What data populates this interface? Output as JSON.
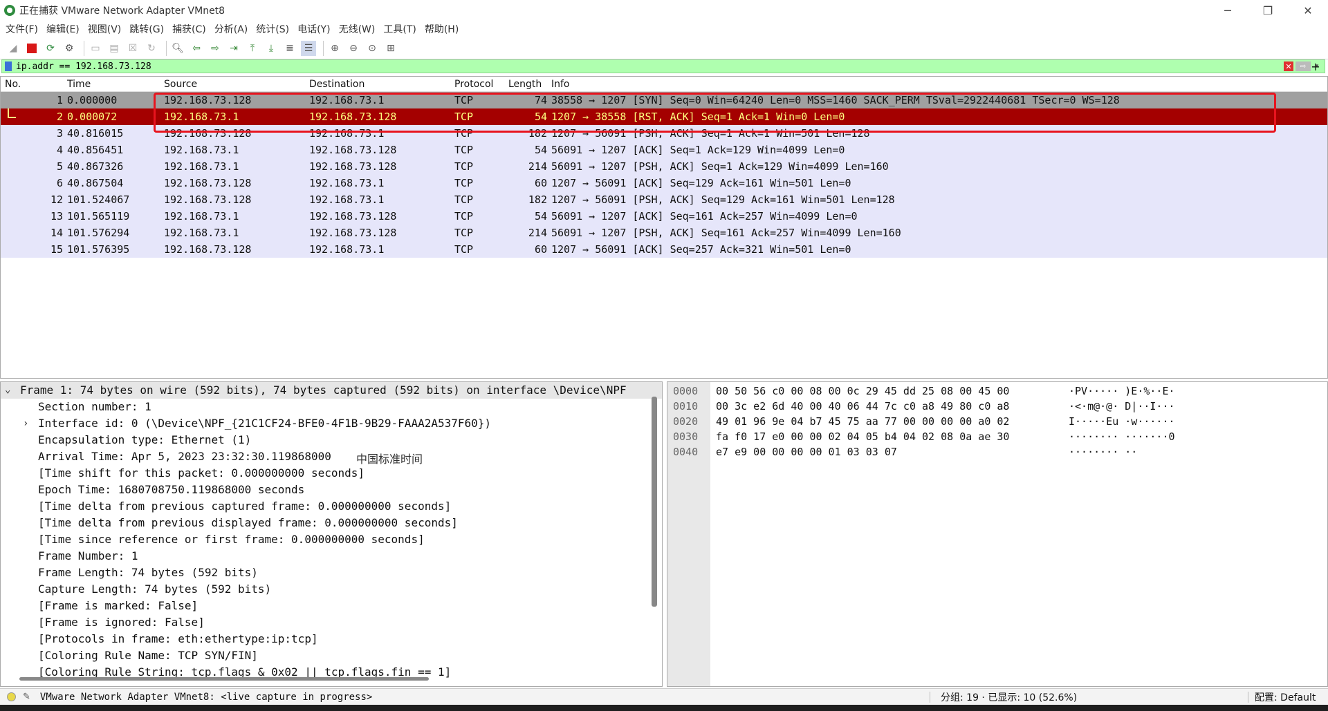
{
  "window": {
    "title": "正在捕获 VMware Network Adapter VMnet8"
  },
  "menu": [
    "文件(F)",
    "编辑(E)",
    "视图(V)",
    "跳转(G)",
    "捕获(C)",
    "分析(A)",
    "统计(S)",
    "电话(Y)",
    "无线(W)",
    "工具(T)",
    "帮助(H)"
  ],
  "filter": {
    "value": "ip.addr == 192.168.73.128",
    "clear_label": "✕",
    "apply_label": "⇨",
    "dropdown_label": "▾",
    "add_label": "+"
  },
  "columns": {
    "no": "No.",
    "time": "Time",
    "source": "Source",
    "destination": "Destination",
    "protocol": "Protocol",
    "length": "Length",
    "info": "Info"
  },
  "packets": [
    {
      "no": "1",
      "time": "0.000000",
      "src": "192.168.73.128",
      "dst": "192.168.73.1",
      "proto": "TCP",
      "len": "74",
      "info": "38558 → 1207 [SYN] Seq=0 Win=64240 Len=0 MSS=1460 SACK_PERM TSval=2922440681 TSecr=0 WS=128"
    },
    {
      "no": "2",
      "time": "0.000072",
      "src": "192.168.73.1",
      "dst": "192.168.73.128",
      "proto": "TCP",
      "len": "54",
      "info": "1207 → 38558 [RST, ACK] Seq=1 Ack=1 Win=0 Len=0"
    },
    {
      "no": "3",
      "time": "40.816015",
      "src": "192.168.73.128",
      "dst": "192.168.73.1",
      "proto": "TCP",
      "len": "182",
      "info": "1207 → 56091 [PSH, ACK] Seq=1 Ack=1 Win=501 Len=128"
    },
    {
      "no": "4",
      "time": "40.856451",
      "src": "192.168.73.1",
      "dst": "192.168.73.128",
      "proto": "TCP",
      "len": "54",
      "info": "56091 → 1207 [ACK] Seq=1 Ack=129 Win=4099 Len=0"
    },
    {
      "no": "5",
      "time": "40.867326",
      "src": "192.168.73.1",
      "dst": "192.168.73.128",
      "proto": "TCP",
      "len": "214",
      "info": "56091 → 1207 [PSH, ACK] Seq=1 Ack=129 Win=4099 Len=160"
    },
    {
      "no": "6",
      "time": "40.867504",
      "src": "192.168.73.128",
      "dst": "192.168.73.1",
      "proto": "TCP",
      "len": "60",
      "info": "1207 → 56091 [ACK] Seq=129 Ack=161 Win=501 Len=0"
    },
    {
      "no": "12",
      "time": "101.524067",
      "src": "192.168.73.128",
      "dst": "192.168.73.1",
      "proto": "TCP",
      "len": "182",
      "info": "1207 → 56091 [PSH, ACK] Seq=129 Ack=161 Win=501 Len=128"
    },
    {
      "no": "13",
      "time": "101.565119",
      "src": "192.168.73.1",
      "dst": "192.168.73.128",
      "proto": "TCP",
      "len": "54",
      "info": "56091 → 1207 [ACK] Seq=161 Ack=257 Win=4099 Len=0"
    },
    {
      "no": "14",
      "time": "101.576294",
      "src": "192.168.73.1",
      "dst": "192.168.73.128",
      "proto": "TCP",
      "len": "214",
      "info": "56091 → 1207 [PSH, ACK] Seq=161 Ack=257 Win=4099 Len=160"
    },
    {
      "no": "15",
      "time": "101.576395",
      "src": "192.168.73.128",
      "dst": "192.168.73.1",
      "proto": "TCP",
      "len": "60",
      "info": "1207 → 56091 [ACK] Seq=257 Ack=321 Win=501 Len=0"
    }
  ],
  "details": {
    "frame": "Frame 1: 74 bytes on wire (592 bits), 74 bytes captured (592 bits) on interface \\Device\\NPF",
    "section": "Section number: 1",
    "interface": "Interface id: 0 (\\Device\\NPF_{21C1CF24-BFE0-4F1B-9B29-FAAA2A537F60})",
    "encap": "Encapsulation type: Ethernet (1)",
    "arrival": "Arrival Time: Apr  5, 2023 23:32:30.119868000",
    "arrival_tz": "中国标准时间",
    "timeshift": "[Time shift for this packet: 0.000000000 seconds]",
    "epoch": "Epoch Time: 1680708750.119868000 seconds",
    "delta_captured": "[Time delta from previous captured frame: 0.000000000 seconds]",
    "delta_displayed": "[Time delta from previous displayed frame: 0.000000000 seconds]",
    "since_ref": "[Time since reference or first frame: 0.000000000 seconds]",
    "frame_number": "Frame Number: 1",
    "frame_length": "Frame Length: 74 bytes (592 bits)",
    "capture_length": "Capture Length: 74 bytes (592 bits)",
    "marked": "[Frame is marked: False]",
    "ignored": "[Frame is ignored: False]",
    "protocols": "[Protocols in frame: eth:ethertype:ip:tcp]",
    "coloring_name": "[Coloring Rule Name: TCP SYN/FIN]",
    "coloring_string": "[Coloring Rule String: tcp.flags & 0x02 || tcp.flags.fin == 1]"
  },
  "bytes": [
    {
      "off": "0000",
      "hex": "00 50 56 c0 00 08 00 0c  29 45 dd 25 08 00 45 00",
      "ascii": "·PV·····  )E·%··E·"
    },
    {
      "off": "0010",
      "hex": "00 3c e2 6d 40 00 40 06  44 7c c0 a8 49 80 c0 a8",
      "ascii": "·<·m@·@·  D|··I···"
    },
    {
      "off": "0020",
      "hex": "49 01 96 9e 04 b7 45 75  aa 77 00 00 00 00 a0 02",
      "ascii": "I·····Eu  ·w······"
    },
    {
      "off": "0030",
      "hex": "fa f0 17 e0 00 00 02 04  05 b4 04 02 08 0a ae 30",
      "ascii": "········  ·······0"
    },
    {
      "off": "0040",
      "hex": "e7 e9 00 00 00 00 01 03  03 07",
      "ascii": "········  ··"
    }
  ],
  "status": {
    "message": "VMware Network Adapter VMnet8: <live capture in progress>",
    "packets": "分组: 19 · 已显示: 10 (52.6%)",
    "profile": "配置: Default"
  },
  "colors": {
    "syn_row": "#a0a0a0",
    "rst_row": "#a40000",
    "normal_row": "#e6e6fa",
    "filter_ok": "#afffaf",
    "highlight_box": "#e8141e"
  }
}
